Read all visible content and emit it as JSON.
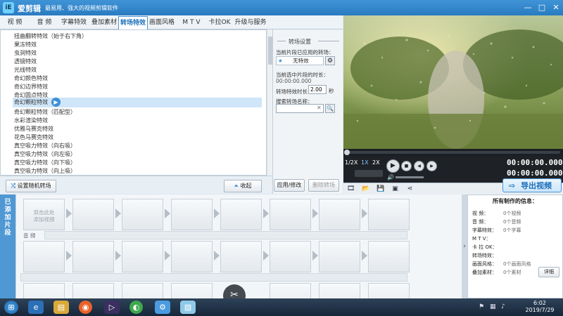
{
  "app": {
    "name": "爱剪辑",
    "slogan": "最易用、强大的视频剪辑软件",
    "logo_text": "iE"
  },
  "tabs": [
    {
      "label": "视  频"
    },
    {
      "label": "音  频"
    },
    {
      "label": "字幕特效"
    },
    {
      "label": "叠加素材"
    },
    {
      "label": "转场特效",
      "active": true
    },
    {
      "label": "画面风格"
    },
    {
      "label": "M T V"
    },
    {
      "label": "卡拉OK"
    },
    {
      "label": "升级与服务"
    }
  ],
  "transition_list": [
    "扭曲翻转特效（始于右下角）",
    "果冻特效",
    "虫洞特效",
    "透镜特效",
    "光线特效",
    "奇幻颜色特效",
    "奇幻边界特效",
    "奇幻圆点特效",
    "奇幻颗粒特效",
    "奇幻颗粒特效（匹配型）",
    "水彩渲染特效",
    "优雅马赛克特效",
    "花色马赛克特效",
    "真空吸力特效（向右吸）",
    "真空吸力特效（向左吸）",
    "真空吸力特效（向下吸）",
    "真空吸力特效（向上吸）"
  ],
  "selected_index": 8,
  "buttons": {
    "random": "设置随机转场",
    "collapse": "收起",
    "apply": "应用/修改",
    "delete": "删除转场"
  },
  "settings": {
    "title": "转场设置",
    "applied_label": "当前片段已应用的转场：",
    "applied_value": "无特效",
    "selected_time_label": "当前选中片段的时长：",
    "selected_time": "00:00:00.000",
    "duration_label": "转场特效时长：",
    "duration_value": "2.00",
    "duration_unit": "秒",
    "search_label": "搜索转场名称：",
    "search_value": ""
  },
  "player": {
    "speed_1_2x": "1/2X",
    "speed_1x": "1X",
    "speed_2x": "2X",
    "time_current": "00:00:00.000",
    "time_total": "00:00:00.000"
  },
  "export_label": "导出视频",
  "timeline": {
    "side_label": "已添加片段",
    "placeholder": "双击此处添加视频",
    "audio_label": "音  频"
  },
  "info": {
    "title": "所有制作的信息：",
    "rows": [
      {
        "k": "视    频：",
        "v": "0个视频"
      },
      {
        "k": "音    频：",
        "v": "0个音频"
      },
      {
        "k": "字幕特效：",
        "v": "0个字幕"
      },
      {
        "k": "M  T  V：",
        "v": ""
      },
      {
        "k": "卡 拉 OK：",
        "v": ""
      },
      {
        "k": "转场特效：",
        "v": ""
      },
      {
        "k": "画面风格：",
        "v": "0个画面风格"
      },
      {
        "k": "叠加素材：",
        "v": "0个素材"
      }
    ],
    "detail": "详细"
  },
  "taskbar": {
    "time": "6:02",
    "date": "2019/7/29"
  },
  "colors": {
    "accent": "#2a7bc1",
    "selected_row": "#cfe5f8",
    "timeline_side": "#4f98d3"
  }
}
